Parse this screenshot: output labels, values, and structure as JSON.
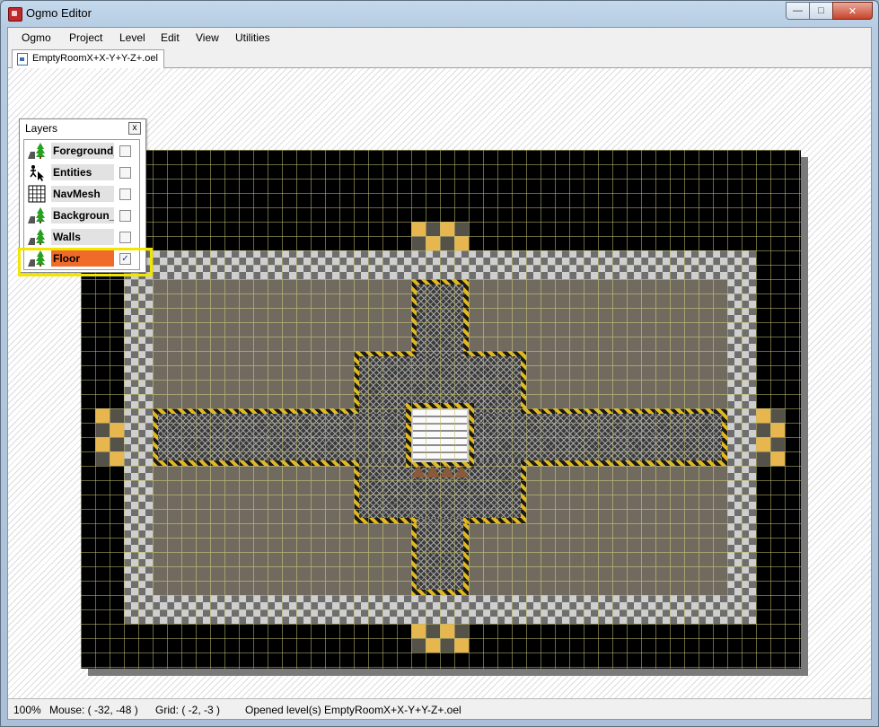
{
  "window": {
    "title": "Ogmo Editor"
  },
  "menu": [
    "Ogmo",
    "Project",
    "Level",
    "Edit",
    "View",
    "Utilities"
  ],
  "tab": {
    "label": "EmptyRoomX+X-Y+Y-Z+.oel"
  },
  "layers_panel": {
    "title": "Layers",
    "close_label": "x",
    "layers": [
      {
        "name": "Foreground_",
        "icon": "tree-tiles-icon",
        "checked": false
      },
      {
        "name": "Entities",
        "icon": "entity-cursor-icon",
        "checked": false
      },
      {
        "name": "NavMesh",
        "icon": "grid-icon",
        "checked": false
      },
      {
        "name": "Backgroun_",
        "icon": "tree-tiles-icon",
        "checked": false
      },
      {
        "name": "Walls",
        "icon": "tree-tiles-icon",
        "checked": false
      },
      {
        "name": "Floor",
        "icon": "tree-tiles-icon",
        "checked": true,
        "active": true
      }
    ],
    "check_mark": "✓"
  },
  "status": {
    "zoom": "100%",
    "mouse": "Mouse: ( -32, -48 )",
    "grid": "Grid: ( -2, -3 )",
    "message": "Opened level(s) EmptyRoomX+X-Y+Y-Z+.oel"
  },
  "colors": {
    "highlight": "#f2e600",
    "active_layer": "#f06b2a",
    "hazard_yellow": "#e2b820"
  }
}
